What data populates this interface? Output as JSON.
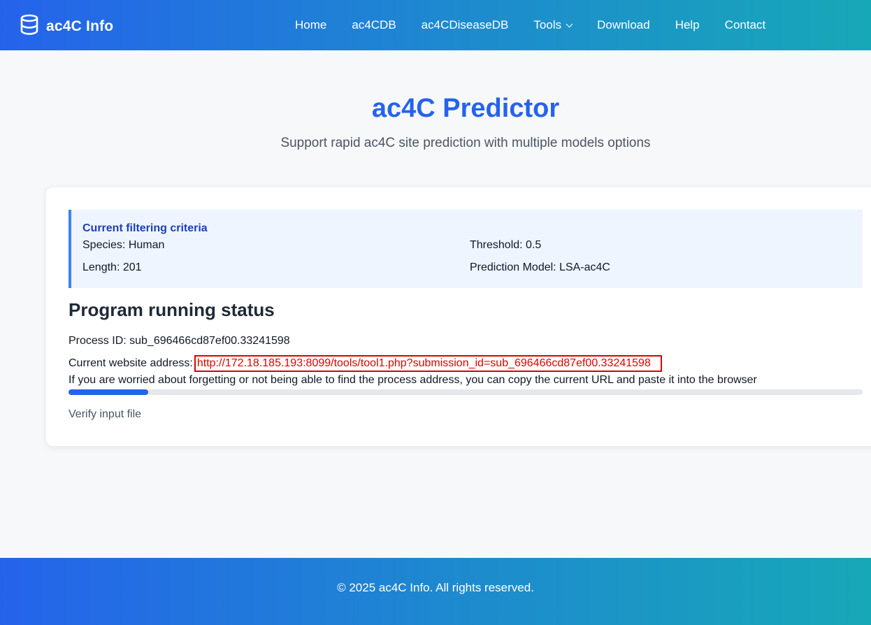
{
  "nav": {
    "brand": "ac4C Info",
    "links": [
      "Home",
      "ac4CDB",
      "ac4CDiseaseDB",
      "Tools",
      "Download",
      "Help",
      "Contact"
    ]
  },
  "header": {
    "title": "ac4C Predictor",
    "subtitle": "Support rapid ac4C site prediction with multiple models options"
  },
  "criteria": {
    "title": "Current filtering criteria",
    "species": "Species: Human",
    "threshold": "Threshold: 0.5",
    "length": "Length: 201",
    "model": "Prediction Model: LSA-ac4C"
  },
  "status": {
    "heading": "Program running status",
    "process_id": "Process ID: sub_696466cd87ef00.33241598",
    "address_label": "Current website address:",
    "address_url": "http://172.18.185.193:8099/tools/tool1.php?submission_id=sub_696466cd87ef00.33241598",
    "hint": "If you are worried about forgetting or not being able to find the process address, you can copy the current URL and paste it into the browser",
    "progress_percent": 10,
    "step": "Verify input file"
  },
  "footer": {
    "text": "© 2025 ac4C Info. All rights reserved."
  },
  "colors": {
    "accent": "#2563eb",
    "highlight": "#e00000"
  }
}
